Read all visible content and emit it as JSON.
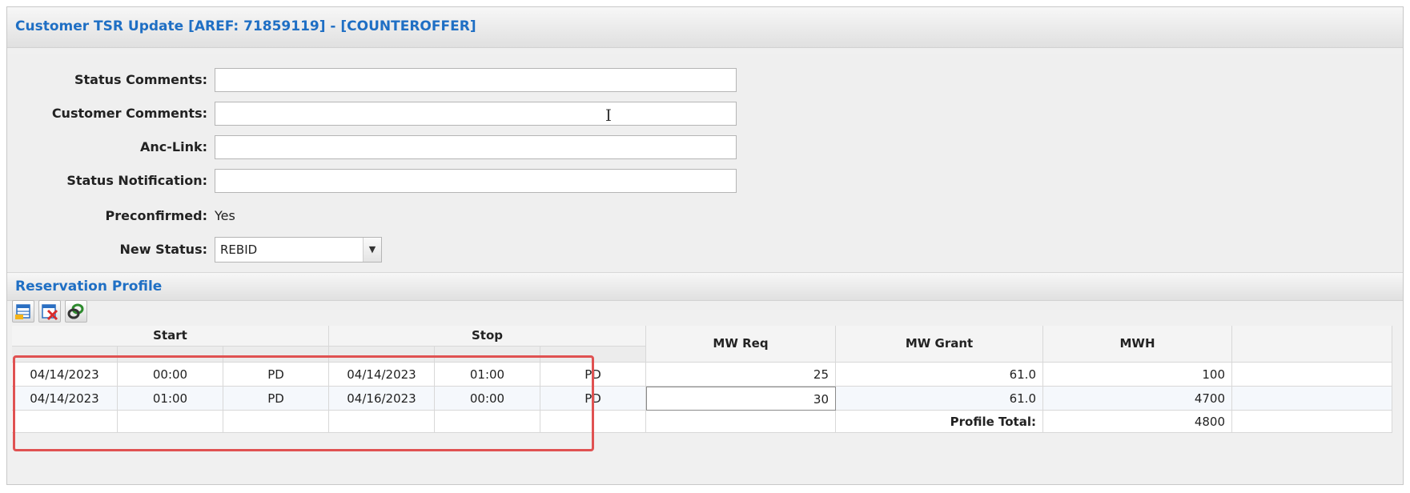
{
  "header": {
    "title": "Customer TSR Update [AREF: 71859119] - [COUNTEROFFER]"
  },
  "form": {
    "status_comments": {
      "label": "Status Comments",
      "value": ""
    },
    "customer_comments": {
      "label": "Customer Comments",
      "value": ""
    },
    "anc_link": {
      "label": "Anc-Link",
      "value": ""
    },
    "status_notification": {
      "label": "Status Notification",
      "value": ""
    },
    "preconfirmed": {
      "label": "Preconfirmed",
      "value": "Yes"
    },
    "new_status": {
      "label": "New Status",
      "value": "REBID"
    },
    "label_suffix": ":"
  },
  "profile": {
    "title": "Reservation Profile",
    "toolbar": {
      "icons": [
        "add-row-icon",
        "delete-row-icon",
        "link-icon"
      ]
    },
    "columns": {
      "start": "Start",
      "stop": "Stop",
      "mw_req": "MW Req",
      "mw_grant": "MW Grant",
      "mwh": "MWH"
    },
    "rows": [
      {
        "start_date": "04/14/2023",
        "start_time": "00:00",
        "start_tz": "PD",
        "stop_date": "04/14/2023",
        "stop_time": "01:00",
        "stop_tz": "PD",
        "mw_req": "25",
        "mw_grant": "61.0",
        "mwh": "100"
      },
      {
        "start_date": "04/14/2023",
        "start_time": "01:00",
        "start_tz": "PD",
        "stop_date": "04/16/2023",
        "stop_time": "00:00",
        "stop_tz": "PD",
        "mw_req": "30",
        "mw_grant": "61.0",
        "mwh": "4700"
      }
    ],
    "total": {
      "label": "Profile Total:",
      "mwh": "4800"
    }
  },
  "colors": {
    "title_blue": "#1f6fc4",
    "highlight_red": "#e05252"
  }
}
